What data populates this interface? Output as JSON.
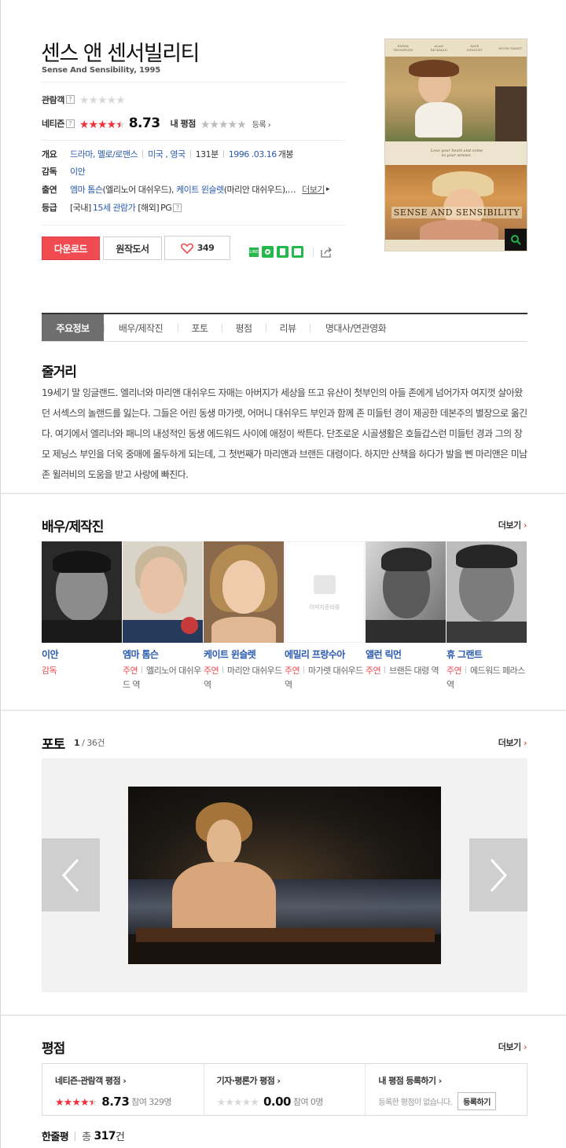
{
  "movie": {
    "title": "센스 앤 센서빌리티",
    "subtitle": "Sense And Sensibility, 1995"
  },
  "ratings_header": {
    "audience_label": "관람객",
    "netizen_label": "네티즌",
    "netizen_score": "8.73",
    "netizen_stars": 4.5,
    "my_rating_label": "내 평점",
    "register_link": "등록"
  },
  "info": {
    "overview_label": "개요",
    "genre": "드라마, 멜로/로맨스",
    "country": "미국 , 영국",
    "runtime": "131분",
    "release_date": "1996 .03.16",
    "release_suffix": "개봉",
    "director_label": "감독",
    "director": "이안",
    "cast_label": "출연",
    "cast_1": "엠마 톰슨",
    "cast_1_role": "(엘리노어 대쉬우드),",
    "cast_2": "케이트 윈슬렛",
    "cast_2_role": "(마리안 대쉬우드),…",
    "cast_more": "더보기",
    "grade_label": "등급",
    "grade_domestic_prefix": "[국내]",
    "grade_domestic": "15세 관람가",
    "grade_foreign_prefix": "[해외]",
    "grade_foreign": "PG"
  },
  "buttons": {
    "download": "다운로드",
    "original_book": "원작도서",
    "like_count": "349"
  },
  "poster": {
    "credits": [
      "EMMA THOMPSON",
      "ALAN RICKMAN",
      "KATE WINSLET",
      "HUGH GRANT"
    ],
    "tagline": "Lose your heart and come to your senses.",
    "title_text": "SENSE AND SENSIBILITY"
  },
  "tabs": [
    "주요정보",
    "배우/제작진",
    "포토",
    "평점",
    "리뷰",
    "명대사/연관영화"
  ],
  "synopsis": {
    "title": "줄거리",
    "text": "19세기 말 잉글랜드. 엘리너와 마리앤 대쉬우드 자매는 아버지가 세상을 뜨고 유산이 첫부인의 아들 존에게 넘어가자 여지껏 살아왔던 서섹스의 놀랜드를 잃는다. 그들은 어린 동생 마가렛, 어머니 대쉬우드 부인과 함께 존 미들턴 경이 제공한 데본주의 별장으로 옮긴다. 여기에서 엘리너와 패니의 내성적인 동생 에드워드 사이에 애정이 싹튼다. 단조로운 시골생활은 호들갑스런 미들턴 경과 그의 장모 제닝스 부인을 더욱 중매에 몰두하게 되는데, 그 첫번째가 마리앤과 브랜든 대령이다. 하지만 산책을 하다가 발을 삔 마리앤은 미남 존 윌러비의 도움을 받고 사랑에 빠진다."
  },
  "cast_section": {
    "title": "배우/제작진",
    "more": "더보기",
    "no_image_text": "이미지준비중",
    "people": [
      {
        "name": "이안",
        "type": "감독",
        "role": ""
      },
      {
        "name": "엠마 톰슨",
        "type": "주연",
        "role": "엘리노어 대쉬우드 역"
      },
      {
        "name": "케이트 윈슬렛",
        "type": "주연",
        "role": "마리안 대쉬우드 역"
      },
      {
        "name": "에밀리 프랑수아",
        "type": "주연",
        "role": "마가렛 대쉬우드 역"
      },
      {
        "name": "앨런 릭먼",
        "type": "주연",
        "role": "브랜든 대령 역"
      },
      {
        "name": "휴 그랜트",
        "type": "주연",
        "role": "에드워드 페라스 역"
      }
    ]
  },
  "photo_section": {
    "title": "포토",
    "current": "1",
    "total": "/ 36건",
    "more": "더보기"
  },
  "rating_section": {
    "title": "평점",
    "more": "더보기",
    "netizen_label": "네티즌·관람객 평점",
    "netizen_score": "8.73",
    "netizen_count": "참여 329명",
    "critic_label": "기자·평론가 평점",
    "critic_score": "0.00",
    "critic_count": "참여 0명",
    "my_label": "내 평점 등록하기",
    "my_text": "등록한 평점이 없습니다.",
    "my_button": "등록하기"
  },
  "oneline": {
    "label": "한줄평",
    "prefix": "총",
    "count": "317",
    "suffix": "건"
  },
  "colors": {
    "accent": "#ef4b51",
    "link": "#2a5ab0",
    "green": "#25b94b"
  }
}
